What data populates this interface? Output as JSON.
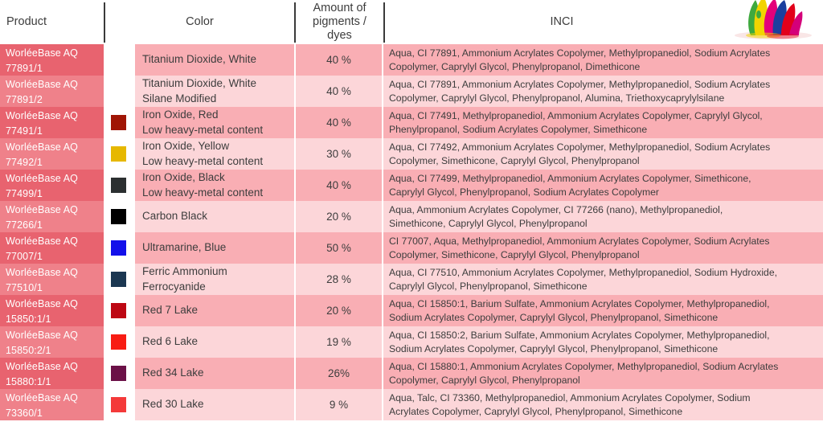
{
  "table": {
    "columns": {
      "product": "Product",
      "color": "Color",
      "amount": "Amount of\npigments /\ndyes",
      "amount_line1": "Amount of",
      "amount_line2": "pigments /",
      "amount_line3": "dyes",
      "inci": "INCI"
    },
    "header_graphic": "paint-splash-image",
    "palette": {
      "product_cell_dark": "#e8636f",
      "product_cell_light": "#ef818a",
      "data_cell_dark": "#f9aeb4",
      "data_cell_light": "#fcd6d9",
      "header_text": "#3c3c3c",
      "body_text": "#3d3d3d",
      "product_text": "#ffffff"
    },
    "rows": [
      {
        "product_line1": "WorléeBase AQ",
        "product_line2": "77891/1",
        "swatch_color": "#ffffff",
        "swatch_name": "titanium-dioxide-white-swatch",
        "color_line1": "Titanium Dioxide, White",
        "color_line2": "",
        "amount": "40 %",
        "inci_line1": "Aqua, CI 77891, Ammonium Acrylates Copolymer, Methylpropanediol, Sodium Acrylates",
        "inci_line2": "Copolymer, Caprylyl Glycol, Phenylpropanol, Dimethicone"
      },
      {
        "product_line1": "WorléeBase AQ",
        "product_line2": "77891/2",
        "swatch_color": "#ffffff",
        "swatch_name": "titanium-dioxide-white-silane-swatch",
        "color_line1": "Titanium Dioxide, White",
        "color_line2": "Silane Modified",
        "amount": "40 %",
        "inci_line1": "Aqua, CI 77891, Ammonium Acrylates Copolymer, Methylpropanediol, Sodium Acrylates",
        "inci_line2": "Copolymer, Caprylyl Glycol, Phenylpropanol, Alumina, Triethoxycaprylylsilane"
      },
      {
        "product_line1": "WorléeBase AQ",
        "product_line2": "77491/1",
        "swatch_color": "#a01505",
        "swatch_name": "iron-oxide-red-swatch",
        "color_line1": "Iron Oxide, Red",
        "color_line2": "Low heavy-metal content",
        "amount": "40 %",
        "inci_line1": "Aqua, CI 77491, Methylpropanediol, Ammonium Acrylates Copolymer, Caprylyl Glycol,",
        "inci_line2": "Phenylpropanol, Sodium Acrylates Copolymer, Simethicone"
      },
      {
        "product_line1": "WorléeBase AQ",
        "product_line2": "77492/1",
        "swatch_color": "#e6b800",
        "swatch_name": "iron-oxide-yellow-swatch",
        "color_line1": "Iron Oxide, Yellow",
        "color_line2": "Low heavy-metal content",
        "amount": "30 %",
        "inci_line1": "Aqua, CI 77492, Ammonium Acrylates Copolymer, Methylpropanediol, Sodium Acrylates",
        "inci_line2": "Copolymer, Simethicone, Caprylyl Glycol, Phenylpropanol"
      },
      {
        "product_line1": "WorléeBase AQ",
        "product_line2": "77499/1",
        "swatch_color": "#2b2f30",
        "swatch_name": "iron-oxide-black-swatch",
        "color_line1": "Iron Oxide, Black",
        "color_line2": "Low heavy-metal content",
        "amount": "40 %",
        "inci_line1": "Aqua, CI 77499, Methylpropanediol, Ammonium Acrylates Copolymer, Simethicone,",
        "inci_line2": "Caprylyl Glycol, Phenylpropanol, Sodium Acrylates Copolymer"
      },
      {
        "product_line1": "WorléeBase AQ",
        "product_line2": "77266/1",
        "swatch_color": "#000000",
        "swatch_name": "carbon-black-swatch",
        "color_line1": "Carbon Black",
        "color_line2": "",
        "amount": "20 %",
        "inci_line1": "Aqua, Ammonium Acrylates Copolymer, CI 77266 (nano), Methylpropanediol,",
        "inci_line2": "Simethicone, Caprylyl Glycol, Phenylpropanol"
      },
      {
        "product_line1": "WorléeBase AQ",
        "product_line2": "77007/1",
        "swatch_color": "#1310ea",
        "swatch_name": "ultramarine-blue-swatch",
        "color_line1": "Ultramarine, Blue",
        "color_line2": "",
        "amount": "50 %",
        "inci_line1": "CI 77007, Aqua, Methylpropanediol, Ammonium Acrylates Copolymer, Sodium Acrylates",
        "inci_line2": "Copolymer, Simethicone, Caprylyl Glycol, Phenylpropanol"
      },
      {
        "product_line1": "WorléeBase AQ",
        "product_line2": "77510/1",
        "swatch_color": "#1b3751",
        "swatch_name": "ferric-ammonium-ferrocyanide-swatch",
        "color_line1": "Ferric Ammonium",
        "color_line2": "Ferrocyanide",
        "amount": "28 %",
        "inci_line1": "Aqua, CI 77510, Ammonium Acrylates Copolymer, Methylpropanediol, Sodium Hydroxide,",
        "inci_line2": "Caprylyl Glycol, Phenylpropanol, Simethicone"
      },
      {
        "product_line1": "WorléeBase AQ",
        "product_line2": "15850:1/1",
        "swatch_color": "#bd0713",
        "swatch_name": "red-7-lake-swatch",
        "color_line1": "Red 7 Lake",
        "color_line2": "",
        "amount": "20 %",
        "inci_line1": "Aqua, CI 15850:1, Barium Sulfate, Ammonium Acrylates Copolymer, Methylpropanediol,",
        "inci_line2": "Sodium Acrylates Copolymer, Caprylyl Glycol, Phenylpropanol, Simethicone"
      },
      {
        "product_line1": "WorléeBase AQ",
        "product_line2": "15850:2/1",
        "swatch_color": "#f81c13",
        "swatch_name": "red-6-lake-swatch",
        "color_line1": "Red 6 Lake",
        "color_line2": "",
        "amount": "19 %",
        "inci_line1": "Aqua, CI 15850:2, Barium Sulfate, Ammonium Acrylates Copolymer, Methylpropanediol,",
        "inci_line2": "Sodium Acrylates Copolymer, Caprylyl Glycol, Phenylpropanol, Simethicone"
      },
      {
        "product_line1": "WorléeBase AQ",
        "product_line2": "15880:1/1",
        "swatch_color": "#6b1047",
        "swatch_name": "red-34-lake-swatch",
        "color_line1": "Red 34 Lake",
        "color_line2": "",
        "amount": "26%",
        "inci_line1": "Aqua, CI 15880:1, Ammonium Acrylates Copolymer, Methylpropanediol, Sodium Acrylates",
        "inci_line2": "Copolymer, Caprylyl Glycol, Phenylpropanol"
      },
      {
        "product_line1": "WorléeBase AQ",
        "product_line2": "73360/1",
        "swatch_color": "#f43a3a",
        "swatch_name": "red-30-lake-swatch",
        "color_line1": "Red 30 Lake",
        "color_line2": "",
        "amount": "9 %",
        "inci_line1": "Aqua, Talc, CI 73360, Methylpropanediol, Ammonium Acrylates Copolymer, Sodium",
        "inci_line2": "Acrylates Copolymer, Caprylyl Glycol, Phenylpropanol, Simethicone"
      }
    ]
  }
}
